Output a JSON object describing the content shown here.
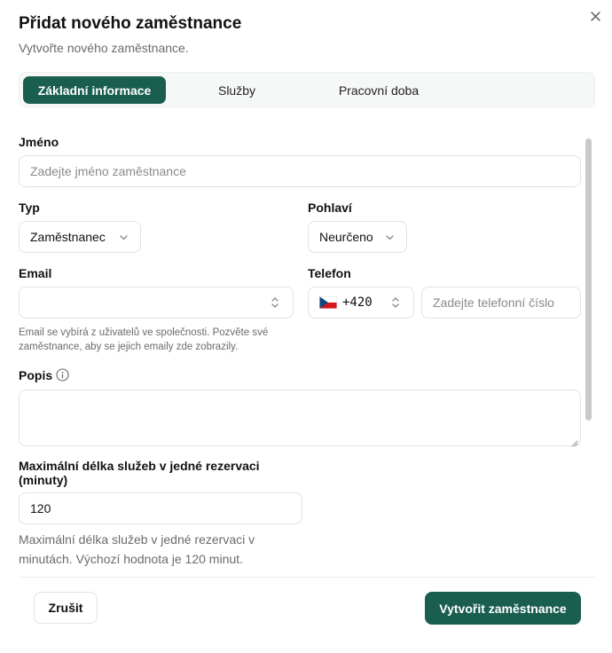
{
  "dialog": {
    "title": "Přidat nového zaměstnance",
    "subtitle": "Vytvořte nového zaměstnance.",
    "close_icon": "close-icon"
  },
  "tabs": [
    {
      "label": "Základní informace",
      "active": true
    },
    {
      "label": "Služby",
      "active": false
    },
    {
      "label": "Pracovní doba",
      "active": false
    }
  ],
  "form": {
    "name": {
      "label": "Jméno",
      "placeholder": "Zadejte jméno zaměstnance",
      "value": ""
    },
    "type": {
      "label": "Typ",
      "value": "Zaměstnanec"
    },
    "gender": {
      "label": "Pohlaví",
      "value": "Neurčeno"
    },
    "email": {
      "label": "Email",
      "value": "",
      "hint": "Email se vybírá z uživatelů ve společnosti. Pozvěte své zaměstnance, aby se jejich emaily zde zobrazily."
    },
    "phone": {
      "label": "Telefon",
      "country_code": "+420",
      "flag": "czech-flag-icon",
      "placeholder": "Zadejte telefonní číslo",
      "value": ""
    },
    "description": {
      "label": "Popis",
      "value": ""
    },
    "max_duration": {
      "label": "Maximální délka služeb v jedné rezervaci (minuty)",
      "value": "120",
      "hint": "Maximální délka služeb v jedné rezervaci v minutách. Výchozí hodnota je 120 minut."
    }
  },
  "footer": {
    "cancel_label": "Zrušit",
    "submit_label": "Vytvořit zaměstnance"
  },
  "colors": {
    "accent": "#1a5e4f"
  }
}
